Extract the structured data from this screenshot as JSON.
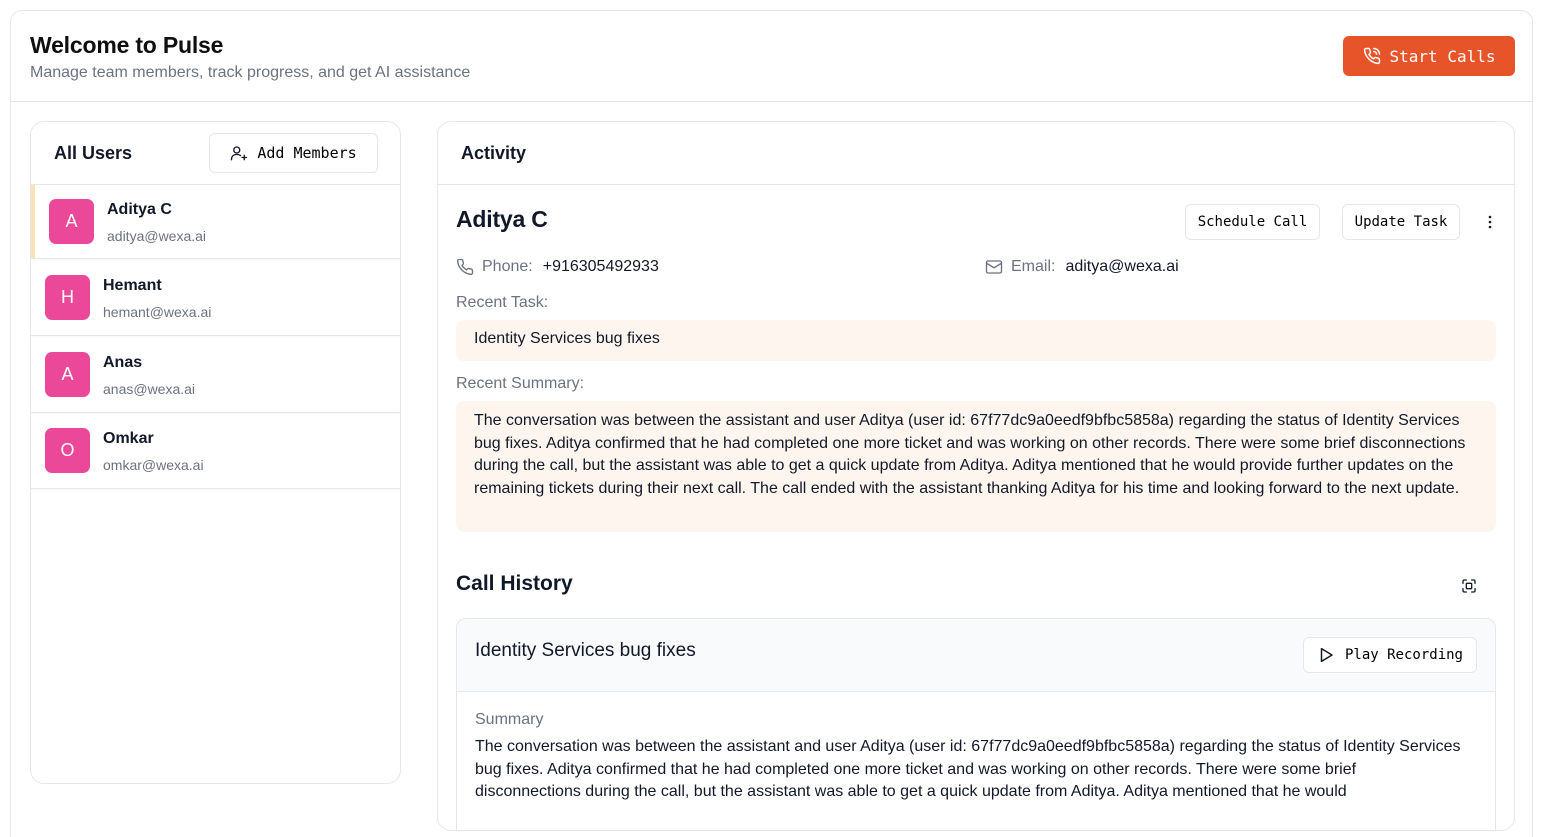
{
  "header": {
    "title": "Welcome to Pulse",
    "subtitle": "Manage team members, track progress, and get AI assistance",
    "start_calls_label": "Start Calls",
    "accent_color": "#e8542a"
  },
  "users_panel": {
    "title": "All Users",
    "add_members_label": "Add Members",
    "users": [
      {
        "initial": "A",
        "name": "Aditya C",
        "email": "aditya@wexa.ai",
        "selected": true
      },
      {
        "initial": "H",
        "name": "Hemant",
        "email": "hemant@wexa.ai",
        "selected": false
      },
      {
        "initial": "A",
        "name": "Anas",
        "email": "anas@wexa.ai",
        "selected": false
      },
      {
        "initial": "O",
        "name": "Omkar",
        "email": "omkar@wexa.ai",
        "selected": false
      }
    ],
    "avatar_color": "#ec4899"
  },
  "activity": {
    "title": "Activity",
    "user_name": "Aditya C",
    "schedule_call_label": "Schedule Call",
    "update_task_label": "Update Task",
    "phone_label": "Phone:",
    "phone_value": "+916305492933",
    "email_label": "Email:",
    "email_value": "aditya@wexa.ai",
    "recent_task_label": "Recent Task:",
    "recent_task": "Identity Services bug fixes",
    "recent_summary_label": "Recent Summary:",
    "recent_summary": "The conversation was between the assistant and user Aditya (user id: 67f77dc9a0eedf9bfbc5858a) regarding the status of Identity Services bug fixes. Aditya confirmed that he had completed one more ticket and was working on other records. There were some brief disconnections during the call, but the assistant was able to get a quick update from Aditya. Aditya mentioned that he would provide further updates on the remaining tickets during their next call. The call ended with the assistant thanking Aditya for his time and looking forward to the next update."
  },
  "call_history": {
    "title": "Call History",
    "calls": [
      {
        "title": "Identity Services bug fixes",
        "play_label": "Play Recording",
        "summary_label": "Summary",
        "summary": "The conversation was between the assistant and user Aditya (user id: 67f77dc9a0eedf9bfbc5858a) regarding the status of Identity Services bug fixes. Aditya confirmed that he had completed one more ticket and was working on other records. There were some brief disconnections during the call, but the assistant was able to get a quick update from Aditya. Aditya mentioned that he would"
      }
    ]
  }
}
